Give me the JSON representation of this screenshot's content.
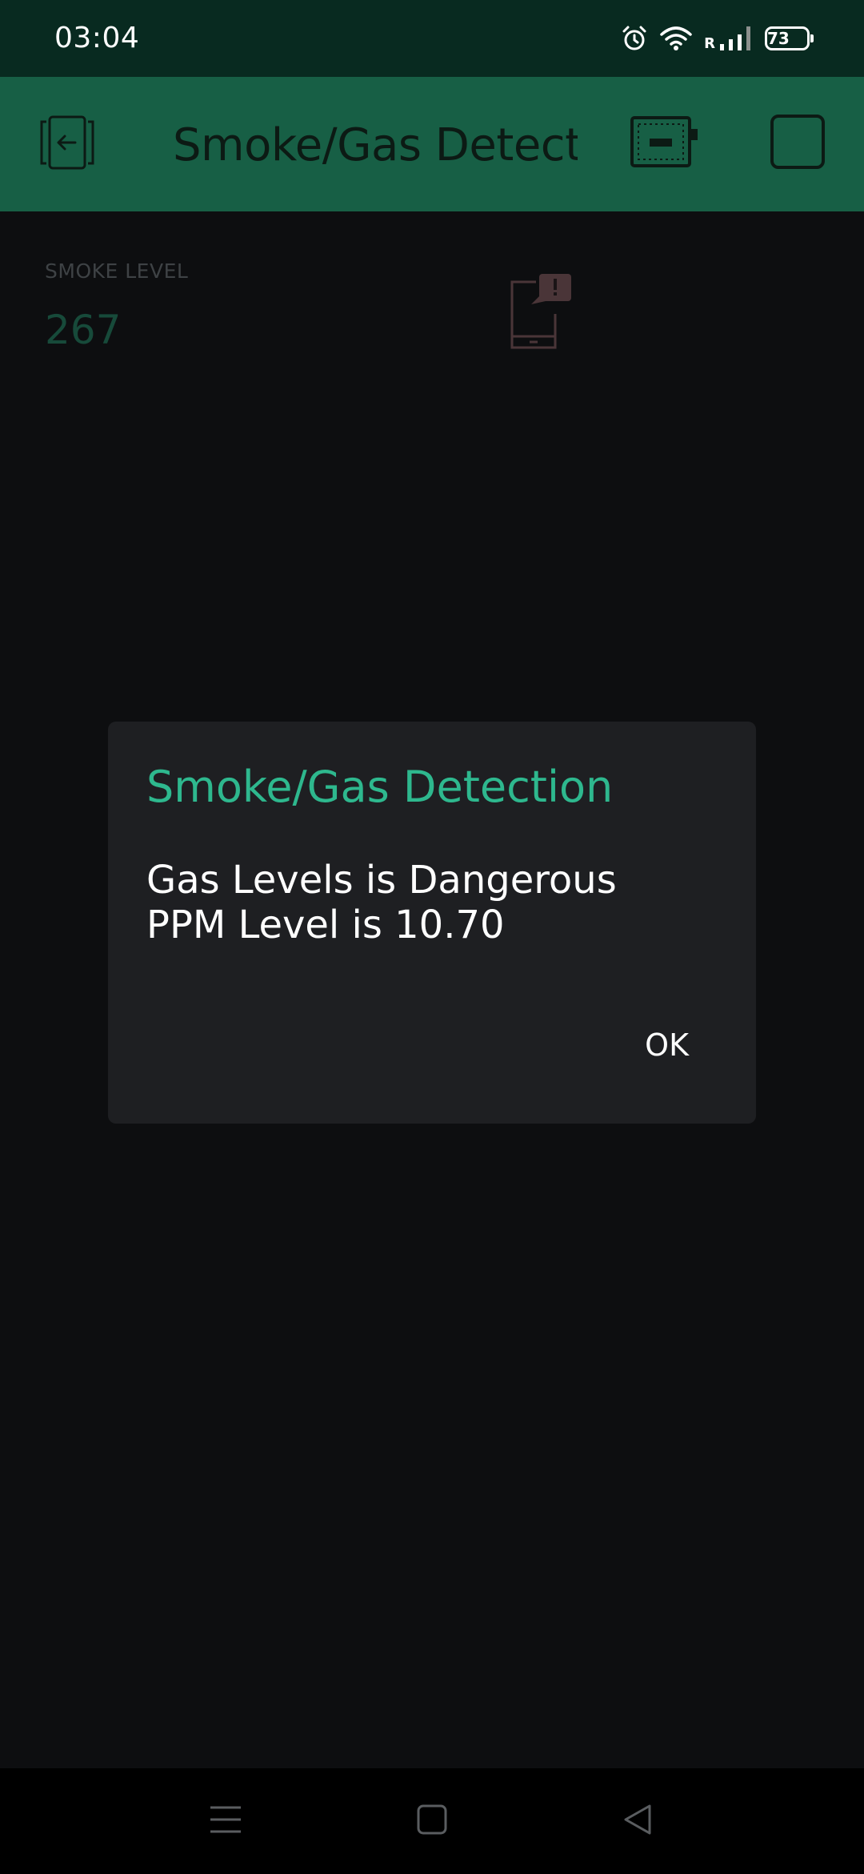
{
  "status_bar": {
    "time": "03:04",
    "roaming": "R",
    "battery": "73",
    "icons": [
      "alarm-icon",
      "wifi-icon",
      "signal-icon",
      "battery-icon"
    ]
  },
  "header": {
    "title": "Smoke/Gas Detection",
    "icons": [
      "exit-icon",
      "device-icon",
      "square-icon"
    ],
    "background": "#175f45"
  },
  "dashboard": {
    "smoke_label": "SMOKE LEVEL",
    "smoke_value": "267",
    "notification_icon": "phone-alert-icon"
  },
  "dialog": {
    "title": "Smoke/Gas Detection",
    "line1": "Gas Levels is Dangerous",
    "line2": "PPM Level is 10.70",
    "ok_label": "OK",
    "accent": "#2eb88e"
  },
  "nav_bar": {
    "icons": [
      "menu-icon",
      "home-icon",
      "back-icon"
    ]
  }
}
